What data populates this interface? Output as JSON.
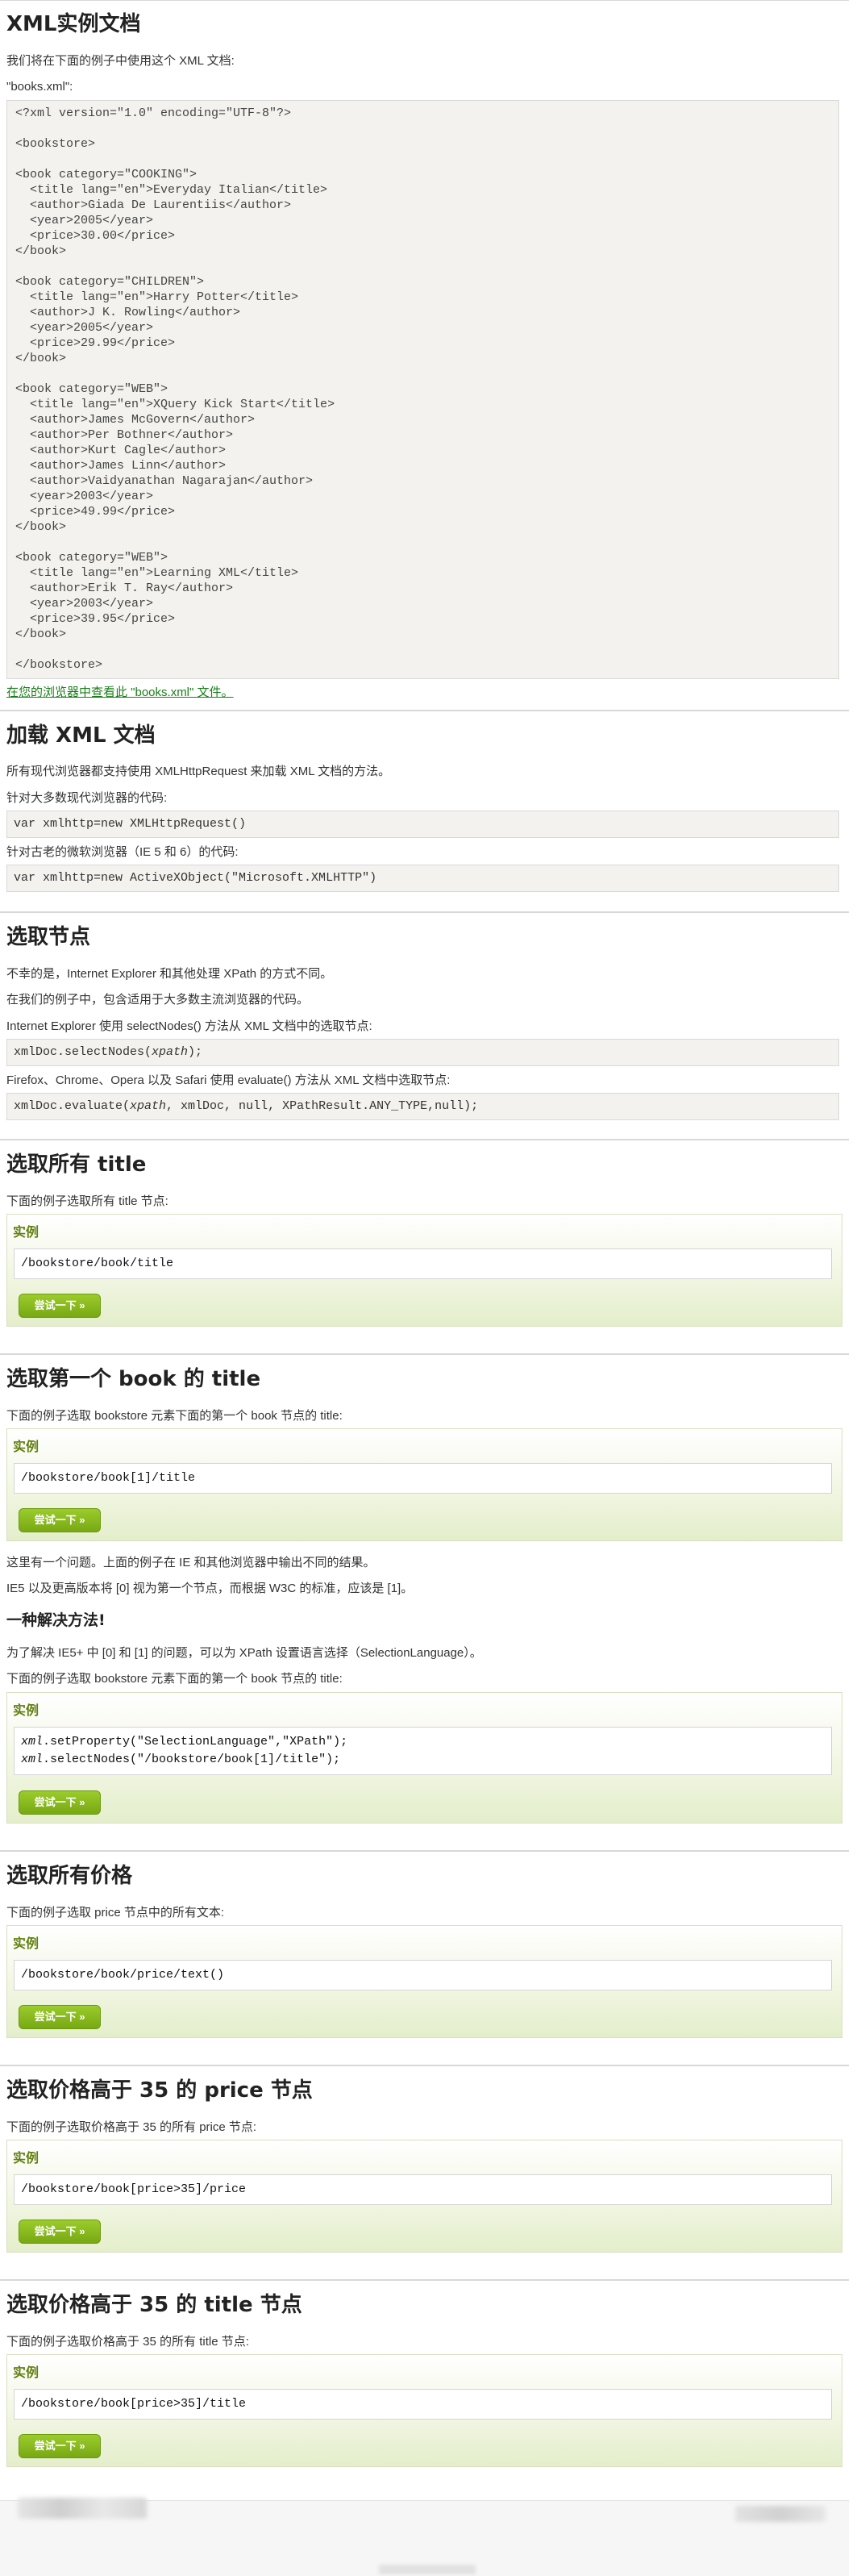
{
  "page_title": "XML实例文档",
  "intro": "我们将在下面的例子中使用这个 XML 文档:",
  "file_label": "\"books.xml\":",
  "xml_source": [
    "<?xml version=\"1.0\" encoding=\"UTF-8\"?>",
    "",
    "<bookstore>",
    "",
    "<book category=\"COOKING\">",
    "  <title lang=\"en\">Everyday Italian</title>",
    "  <author>Giada De Laurentiis</author>",
    "  <year>2005</year>",
    "  <price>30.00</price>",
    "</book>",
    "",
    "<book category=\"CHILDREN\">",
    "  <title lang=\"en\">Harry Potter</title>",
    "  <author>J K. Rowling</author>",
    "  <year>2005</year>",
    "  <price>29.99</price>",
    "</book>",
    "",
    "<book category=\"WEB\">",
    "  <title lang=\"en\">XQuery Kick Start</title>",
    "  <author>James McGovern</author>",
    "  <author>Per Bothner</author>",
    "  <author>Kurt Cagle</author>",
    "  <author>James Linn</author>",
    "  <author>Vaidyanathan Nagarajan</author>",
    "  <year>2003</year>",
    "  <price>49.99</price>",
    "</book>",
    "",
    "<book category=\"WEB\">",
    "  <title lang=\"en\">Learning XML</title>",
    "  <author>Erik T. Ray</author>",
    "  <year>2003</year>",
    "  <price>39.95</price>",
    "</book>",
    "",
    "</bookstore>"
  ],
  "view_link": "在您的浏览器中查看此 \"books.xml\" 文件。",
  "load": {
    "title": "加载 XML 文档",
    "desc": "所有现代浏览器都支持使用 XMLHttpRequest 来加载 XML 文档的方法。",
    "modern_label": "针对大多数现代浏览器的代码:",
    "modern_code": "var xmlhttp=new XMLHttpRequest()",
    "old_label": "针对古老的微软浏览器（IE 5 和 6）的代码:",
    "old_code": "var xmlhttp=new ActiveXObject(\"Microsoft.XMLHTTP\")"
  },
  "select": {
    "title": "选取节点",
    "p1": "不幸的是，Internet Explorer 和其他处理 XPath 的方式不同。",
    "p2": "在我们的例子中，包含适用于大多数主流浏览器的代码。",
    "p3": "Internet Explorer 使用 selectNodes() 方法从 XML 文档中的选取节点:",
    "code_ie_a": "xmlDoc.selectNodes(",
    "code_ie_b": "xpath",
    "code_ie_c": ");",
    "p4": "Firefox、Chrome、Opera 以及 Safari 使用 evaluate() 方法从 XML 文档中选取节点:",
    "code_ff_a": "xmlDoc.evaluate(",
    "code_ff_b": "xpath",
    "code_ff_c": ", xmlDoc, null, XPathResult.ANY_TYPE,null);"
  },
  "example_label": "实例",
  "try_label": "尝试一下 »",
  "sec_all_titles": {
    "title": "选取所有 title",
    "desc": "下面的例子选取所有 title 节点:",
    "code": "/bookstore/book/title"
  },
  "sec_first_title": {
    "title": "选取第一个 book 的 title",
    "desc": "下面的例子选取 bookstore 元素下面的第一个 book 节点的 title:",
    "code": "/bookstore/book[1]/title",
    "note1": "这里有一个问题。上面的例子在 IE 和其他浏览器中输出不同的结果。",
    "note2": "IE5 以及更高版本将 [0] 视为第一个节点，而根据 W3C 的标准，应该是 [1]。"
  },
  "solution": {
    "title": "一种解决方法!",
    "p1": "为了解决 IE5+ 中 [0] 和 [1] 的问题，可以为 XPath 设置语言选择（SelectionLanguage）。",
    "p2": "下面的例子选取 bookstore 元素下面的第一个 book 节点的 title:",
    "line1_a": "xml",
    "line1_b": ".setProperty(\"SelectionLanguage\",\"XPath\");",
    "line2_a": "xml",
    "line2_b": ".selectNodes(\"/bookstore/book[1]/title\");"
  },
  "sec_prices": {
    "title": "选取所有价格",
    "desc": "下面的例子选取 price 节点中的所有文本:",
    "code": "/bookstore/book/price/text()"
  },
  "sec_price_gt": {
    "title": "选取价格高于 35 的 price 节点",
    "desc": "下面的例子选取价格高于 35 的所有 price 节点:",
    "code": "/bookstore/book[price>35]/price"
  },
  "sec_title_gt": {
    "title": "选取价格高于 35 的 title 节点",
    "desc": "下面的例子选取价格高于 35 的所有 title 节点:",
    "code": "/bookstore/book[price>35]/title"
  },
  "colors": {
    "link": "#1a7f1a",
    "example_label": "#617f10",
    "button": "#8fbf22",
    "code_bg": "#f3f2ee"
  }
}
